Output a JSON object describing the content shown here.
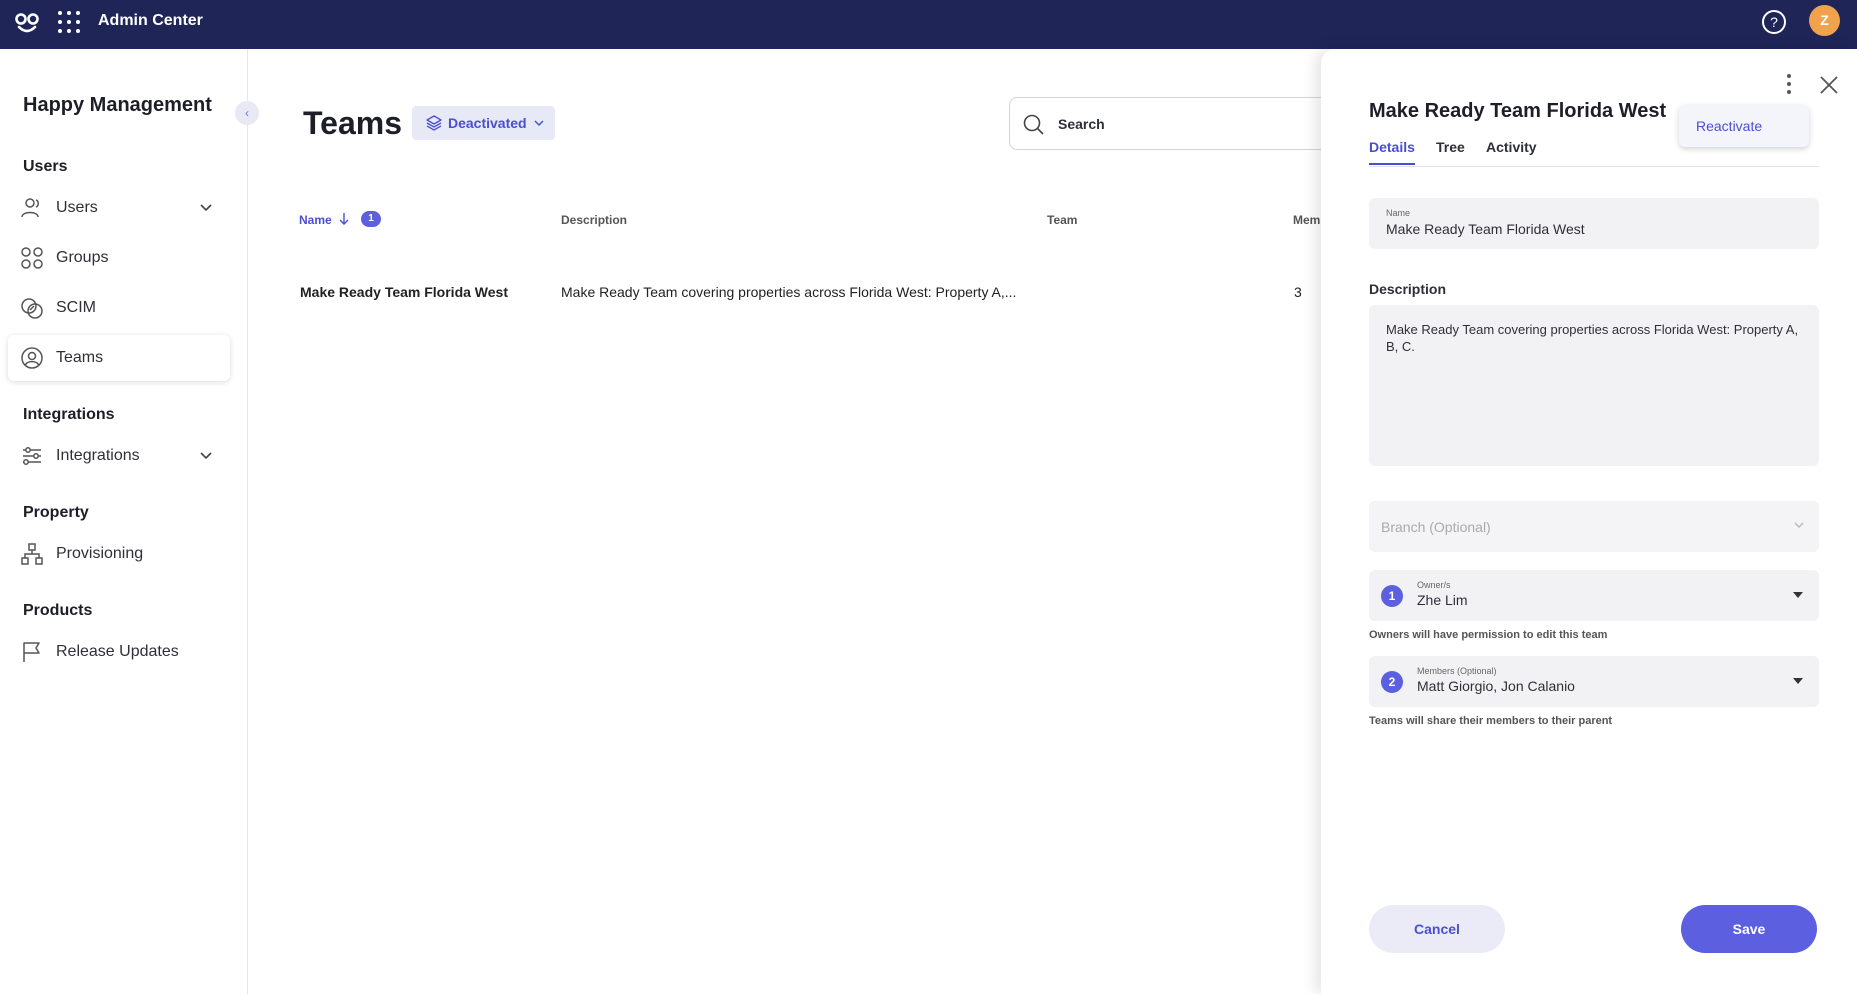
{
  "app": {
    "title": "Admin Center",
    "user_initial": "Z",
    "help_glyph": "?"
  },
  "sidebar": {
    "org_name": "Happy Management",
    "collapse_glyph": "‹",
    "sections": [
      {
        "title": "Users",
        "items": [
          {
            "label": "Users",
            "icon": "user-icon",
            "expandable": true
          },
          {
            "label": "Groups",
            "icon": "groups-icon"
          },
          {
            "label": "SCIM",
            "icon": "scim-icon"
          },
          {
            "label": "Teams",
            "icon": "team-icon",
            "active": true
          }
        ]
      },
      {
        "title": "Integrations",
        "items": [
          {
            "label": "Integrations",
            "icon": "integrations-icon",
            "expandable": true
          }
        ]
      },
      {
        "title": "Property",
        "items": [
          {
            "label": "Provisioning",
            "icon": "hierarchy-icon"
          }
        ]
      },
      {
        "title": "Products",
        "items": [
          {
            "label": "Release Updates",
            "icon": "flag-icon"
          }
        ]
      }
    ]
  },
  "main": {
    "title": "Teams",
    "status_filter": "Deactivated",
    "search_placeholder": "Search",
    "table": {
      "headers": {
        "name": "Name",
        "sort_count": "1",
        "description": "Description",
        "team": "Team",
        "members": "Mem"
      },
      "rows": [
        {
          "name": "Make Ready Team Florida West",
          "description": "Make Ready Team covering properties across Florida West: Property A,...",
          "members": "3"
        }
      ]
    }
  },
  "panel": {
    "title": "Make Ready Team Florida West",
    "menu_action": "Reactivate",
    "tabs": [
      "Details",
      "Tree",
      "Activity"
    ],
    "name_label": "Name",
    "name_value": "Make Ready Team Florida West",
    "description_label": "Description",
    "description_value": "Make Ready Team covering properties across Florida West: Property A, B, C.",
    "branch_placeholder": "Branch (Optional)",
    "owners": {
      "step": "1",
      "label": "Owner/s",
      "value": "Zhe Lim",
      "hint": "Owners will have permission to edit this team"
    },
    "members": {
      "step": "2",
      "label": "Members (Optional)",
      "value": "Matt Giorgio, Jon Calanio",
      "hint": "Teams will share their members to their parent"
    },
    "cancel_label": "Cancel",
    "save_label": "Save"
  },
  "colors": {
    "topbar": "#1f2557",
    "accent": "#5b5fe0",
    "avatar": "#f0a24c"
  }
}
